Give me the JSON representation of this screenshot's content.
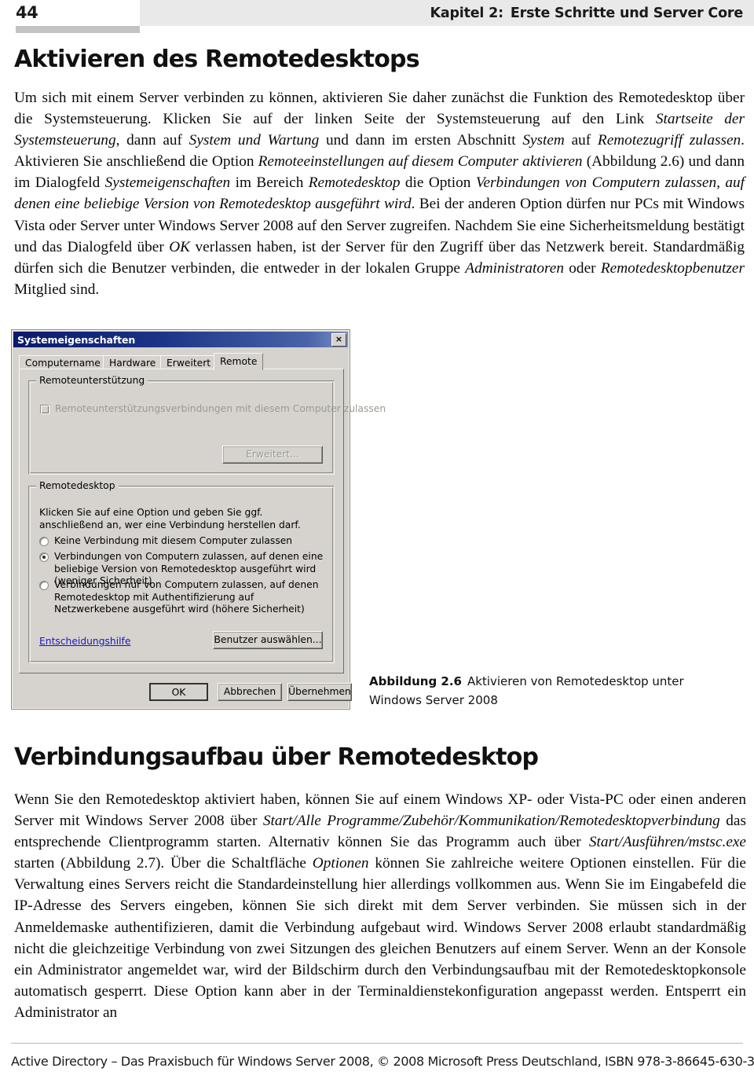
{
  "header": {
    "page_number": "44",
    "chapter_label": "Kapitel 2:",
    "chapter_title": "Erste Schritte und Server Core"
  },
  "headings": {
    "section_1": "Aktivieren des Remotedesktops",
    "section_2": "Verbindungsaufbau über Remotedesktop"
  },
  "paragraphs": {
    "p1_runs": [
      {
        "text": "Um sich mit einem Server verbinden zu können, aktivieren Sie daher zunächst die Funktion des Remotedesktop über die Systemsteuerung. Klicken Sie auf der linken Seite der Systemsteuerung auf den Link ",
        "italic": false
      },
      {
        "text": "Startseite der Systemsteuerung",
        "italic": true
      },
      {
        "text": ", dann auf ",
        "italic": false
      },
      {
        "text": "System und Wartung",
        "italic": true
      },
      {
        "text": " und dann im ersten Abschnitt ",
        "italic": false
      },
      {
        "text": "System",
        "italic": true
      },
      {
        "text": " auf ",
        "italic": false
      },
      {
        "text": "Remotezugriff zulassen",
        "italic": true
      },
      {
        "text": ". Aktivieren Sie anschließend die Option ",
        "italic": false
      },
      {
        "text": "Remoteeinstellungen auf diesem Computer aktivieren",
        "italic": true
      },
      {
        "text": " (Abbildung 2.6) und dann im Dialogfeld ",
        "italic": false
      },
      {
        "text": "Systemeigenschaften",
        "italic": true
      },
      {
        "text": " im Bereich ",
        "italic": false
      },
      {
        "text": "Remotedesktop",
        "italic": true
      },
      {
        "text": " die Option ",
        "italic": false
      },
      {
        "text": "Verbindungen von Computern zulassen, auf denen eine beliebige Version von Remotedesktop ausgeführt wird",
        "italic": true
      },
      {
        "text": ". Bei der anderen Option dürfen nur PCs mit Windows Vista oder Server unter Windows Server 2008 auf den Server zugreifen. Nachdem Sie eine Sicherheitsmeldung bestätigt und das Dialogfeld über ",
        "italic": false
      },
      {
        "text": "OK",
        "italic": true
      },
      {
        "text": " verlassen haben, ist der Server für den Zugriff über das Netzwerk bereit. Standardmäßig dürfen sich die Benutzer verbinden, die entweder in der lokalen Gruppe ",
        "italic": false
      },
      {
        "text": "Administratoren",
        "italic": true
      },
      {
        "text": " oder ",
        "italic": false
      },
      {
        "text": "Remotedesktopbenutzer",
        "italic": true
      },
      {
        "text": " Mitglied sind.",
        "italic": false
      }
    ],
    "p2_runs": [
      {
        "text": "Wenn Sie den Remotedesktop aktiviert haben, können Sie auf einem Windows XP- oder Vista-PC oder einen anderen Server mit Windows Server 2008 über ",
        "italic": false
      },
      {
        "text": "Start/Alle Programme/Zubehör/Kommunikation/Remotedesktopverbindung",
        "italic": true
      },
      {
        "text": " das entsprechende Clientprogramm starten. Alternativ können Sie das Programm auch über ",
        "italic": false
      },
      {
        "text": "Start/Ausführen/mstsc.exe",
        "italic": true
      },
      {
        "text": " starten (Abbildung 2.7). Über die Schaltfläche ",
        "italic": false
      },
      {
        "text": "Optionen",
        "italic": true
      },
      {
        "text": " können Sie zahlreiche weitere Optionen einstellen. Für die Verwaltung eines Servers reicht die Standardeinstellung hier allerdings vollkommen aus. Wenn Sie im Eingabefeld die IP-Adresse des Servers eingeben, können Sie sich direkt mit dem Server verbinden. Sie müssen sich in der Anmeldemaske authentifizieren, damit die Verbindung aufgebaut wird. Windows Server 2008 erlaubt standardmäßig nicht die gleichzeitige Verbindung von zwei Sitzungen des gleichen Benutzers auf einem Server. Wenn an der Konsole ein Administrator angemeldet war, wird der Bildschirm durch den Verbindungsaufbau mit der Remotedesktopkonsole automatisch gesperrt. Diese Option kann aber in der Terminaldienstekonfiguration angepasst werden. Entsperrt ein Administrator an",
        "italic": false
      }
    ]
  },
  "dialog": {
    "title": "Systemeigenschaften",
    "close_icon": "×",
    "tabs": [
      {
        "label": "Computername",
        "active": false
      },
      {
        "label": "Hardware",
        "active": false
      },
      {
        "label": "Erweitert",
        "active": false
      },
      {
        "label": "Remote",
        "active": true
      }
    ],
    "group_assistance": {
      "legend": "Remoteunterstützung",
      "checkbox_label": "Remoteunterstützungsverbindungen mit diesem Computer zulassen",
      "checkbox_checked": false,
      "advanced_button": "Erweitert..."
    },
    "group_remotedesktop": {
      "legend": "Remotedesktop",
      "hint": "Klicken Sie auf eine Option und geben Sie ggf. anschließend an, wer eine Verbindung herstellen darf.",
      "options": [
        {
          "label": "Keine Verbindung mit diesem Computer zulassen",
          "selected": false
        },
        {
          "label": "Verbindungen von Computern zulassen, auf denen eine beliebige Version von Remotedesktop ausgeführt wird (weniger Sicherheit)",
          "selected": true
        },
        {
          "label": "Verbindungen nur von Computern zulassen, auf denen Remotedesktop mit Authentifizierung auf Netzwerkebene ausgeführt wird (höhere Sicherheit)",
          "selected": false
        }
      ],
      "help_link": "Entscheidungshilfe",
      "select_users_button": "Benutzer auswählen..."
    },
    "buttons": {
      "ok": "OK",
      "cancel": "Abbrechen",
      "apply": "Übernehmen"
    }
  },
  "figure_caption": {
    "label": "Abbildung 2.6",
    "text": "Aktivieren von Remotedesktop unter Windows Server 2008"
  },
  "footer": {
    "text": "Active Directory – Das Praxisbuch für Windows Server 2008, © 2008 Microsoft Press Deutschland, ISBN 978-3-86645-630-3"
  },
  "colors": {
    "header_band": "#e9e9e9",
    "header_underbar": "#c3c3c3",
    "dialog_face": "#d6d3ce",
    "titlebar_start": "#0a1a6b",
    "titlebar_end": "#7d90c4",
    "link": "#1616c8",
    "disabled_text": "#9a9a92"
  }
}
